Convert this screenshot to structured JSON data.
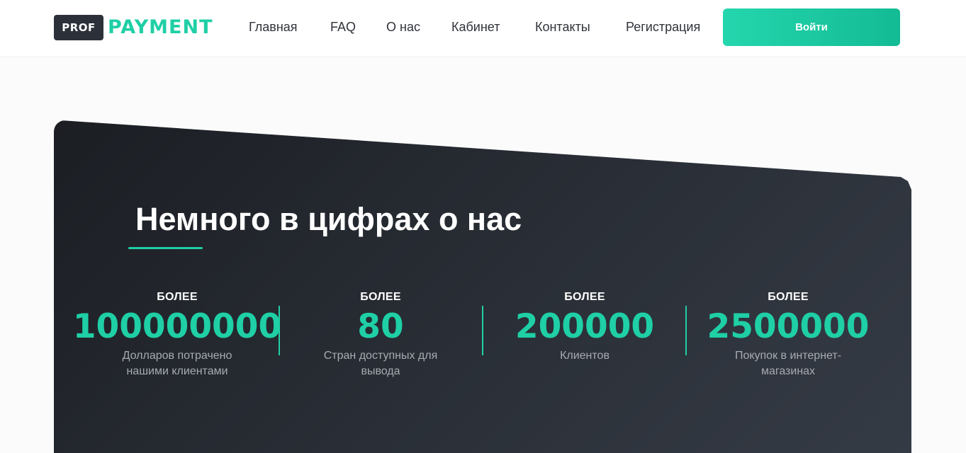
{
  "header": {
    "logo_box": "PROF",
    "logo_text": "PAYMENT",
    "nav": [
      {
        "label": "Главная"
      },
      {
        "label": "FAQ"
      },
      {
        "label": "О нас"
      },
      {
        "label": "Кабинет"
      },
      {
        "label": "Контакты"
      },
      {
        "label": "Регистрация"
      }
    ],
    "login_label": "Войти"
  },
  "stats_section": {
    "title": "Немного в цифрах о нас",
    "items": [
      {
        "prefix": "БОЛЕЕ",
        "value": "100000000",
        "description": "Долларов потрачено нашими клиентами"
      },
      {
        "prefix": "БОЛЕЕ",
        "value": "80",
        "description": "Стран доступных для вывода"
      },
      {
        "prefix": "БОЛЕЕ",
        "value": "200000",
        "description": "Клиентов"
      },
      {
        "prefix": "БОЛЕЕ",
        "value": "2500000",
        "description": "Покупок в интернет-магазинах"
      }
    ]
  },
  "colors": {
    "accent": "#1fcfa5",
    "panel_dark": "#1b1e23",
    "logo_box": "#2c3038"
  }
}
